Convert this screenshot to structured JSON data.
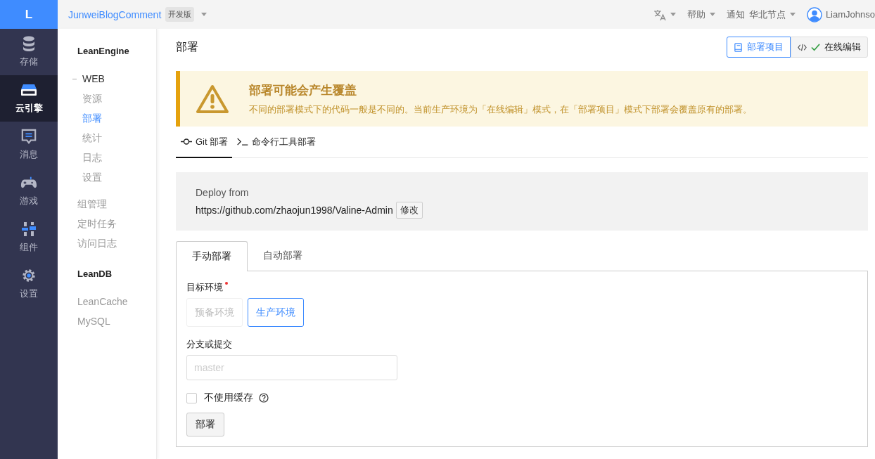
{
  "brand": {
    "logo": "L"
  },
  "topbar": {
    "app_name": "JunweiBlogComment",
    "badge": "开发版",
    "menu": [
      {
        "kind": "icon",
        "dropdown": true
      },
      {
        "kind": "text",
        "label": "帮助",
        "dropdown": true
      },
      {
        "kind": "text",
        "label": "通知",
        "dropdown": false
      },
      {
        "kind": "text",
        "label": "华北节点",
        "dropdown": true
      },
      {
        "kind": "user",
        "label": "LiamJohnso",
        "dropdown": false
      }
    ]
  },
  "rail": [
    {
      "label": "存储",
      "selected": false
    },
    {
      "label": "云引擎",
      "selected": true
    },
    {
      "label": "消息",
      "selected": false
    },
    {
      "label": "游戏",
      "selected": false
    },
    {
      "label": "组件",
      "selected": false
    },
    {
      "label": "设置",
      "selected": false
    }
  ],
  "nav": [
    {
      "title": "LeanEngine",
      "items": [
        {
          "label": "WEB",
          "selected": false,
          "expanded": true,
          "children": [
            {
              "label": "资源",
              "selected": false
            },
            {
              "label": "部署",
              "selected": true
            },
            {
              "label": "统计",
              "selected": false
            },
            {
              "label": "日志",
              "selected": false
            },
            {
              "label": "设置",
              "selected": false
            }
          ]
        },
        {
          "label": "组管理",
          "selected": false
        },
        {
          "label": "定时任务",
          "selected": false
        },
        {
          "label": "访问日志",
          "selected": false
        }
      ]
    },
    {
      "title": "LeanDB",
      "items": [
        {
          "label": "LeanCache",
          "selected": false
        },
        {
          "label": "MySQL",
          "selected": false
        }
      ]
    }
  ],
  "main": {
    "title": "部署",
    "modes": [
      {
        "label": "部署项目",
        "selected": true,
        "current": false
      },
      {
        "label": "在线编辑",
        "selected": false,
        "current": true
      }
    ],
    "alert": {
      "title": "部署可能会产生覆盖",
      "text": "不同的部署模式下的代码一般是不同的。当前生产环境为「在线编辑」模式，在「部署项目」模式下部署会覆盖原有的部署。"
    },
    "tabs": [
      {
        "label": "Git 部署",
        "selected": true
      },
      {
        "label": "命令行工具部署",
        "selected": false
      }
    ],
    "deploy_from": {
      "label": "Deploy from",
      "url": "https://github.com/zhaojun1998/Valine-Admin",
      "button": "修改"
    },
    "subtabs": [
      {
        "label": "手动部署",
        "selected": true
      },
      {
        "label": "自动部署",
        "selected": false
      }
    ],
    "form": {
      "env_label": "目标环境",
      "required": true,
      "envs": [
        {
          "label": "预备环境",
          "selected": false,
          "disabled": true
        },
        {
          "label": "生产环境",
          "selected": true,
          "disabled": false
        }
      ],
      "branch_label": "分支或提交",
      "branch_placeholder": "master",
      "no_cache": {
        "label": "不使用缓存",
        "checked": false
      },
      "submit": "部署"
    }
  }
}
